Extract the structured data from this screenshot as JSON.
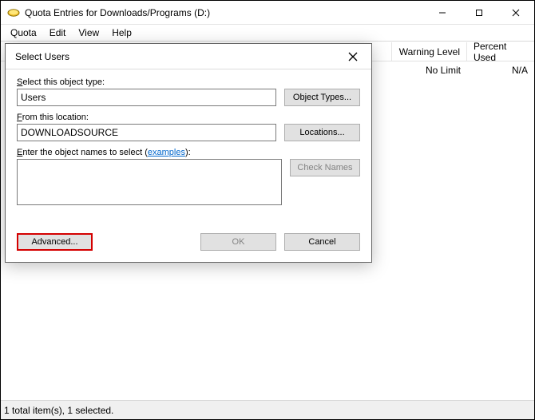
{
  "main": {
    "title": "Quota Entries for Downloads/Programs (D:)",
    "menu": {
      "quota": "Quota",
      "edit": "Edit",
      "view": "View",
      "help": "Help"
    },
    "columns": {
      "warning": "Warning Level",
      "percent": "Percent Used"
    },
    "row0": {
      "warning": "No Limit",
      "percent": "N/A"
    },
    "status": "1 total item(s), 1 selected."
  },
  "dialog": {
    "title": "Select Users",
    "close_label": "Close",
    "obj_type_label_pre": "S",
    "obj_type_label_rest": "elect this object type:",
    "obj_type_value": "Users",
    "obj_type_btn_pre": "O",
    "obj_type_btn_rest": "bject Types...",
    "loc_label_pre": "F",
    "loc_label_rest": "rom this location:",
    "loc_value": "DOWNLOADSOURCE",
    "loc_btn_pre": "L",
    "loc_btn_rest": "ocations...",
    "names_label_pre": "E",
    "names_label_rest": "nter the object names to select (",
    "names_example": "examples",
    "names_label_close": "):",
    "names_value": "",
    "check_btn_pre": "C",
    "check_btn_rest": "heck Names",
    "advanced_btn_pre": "A",
    "advanced_btn_rest": "dvanced...",
    "ok_btn": "OK",
    "cancel_btn": "Cancel"
  }
}
